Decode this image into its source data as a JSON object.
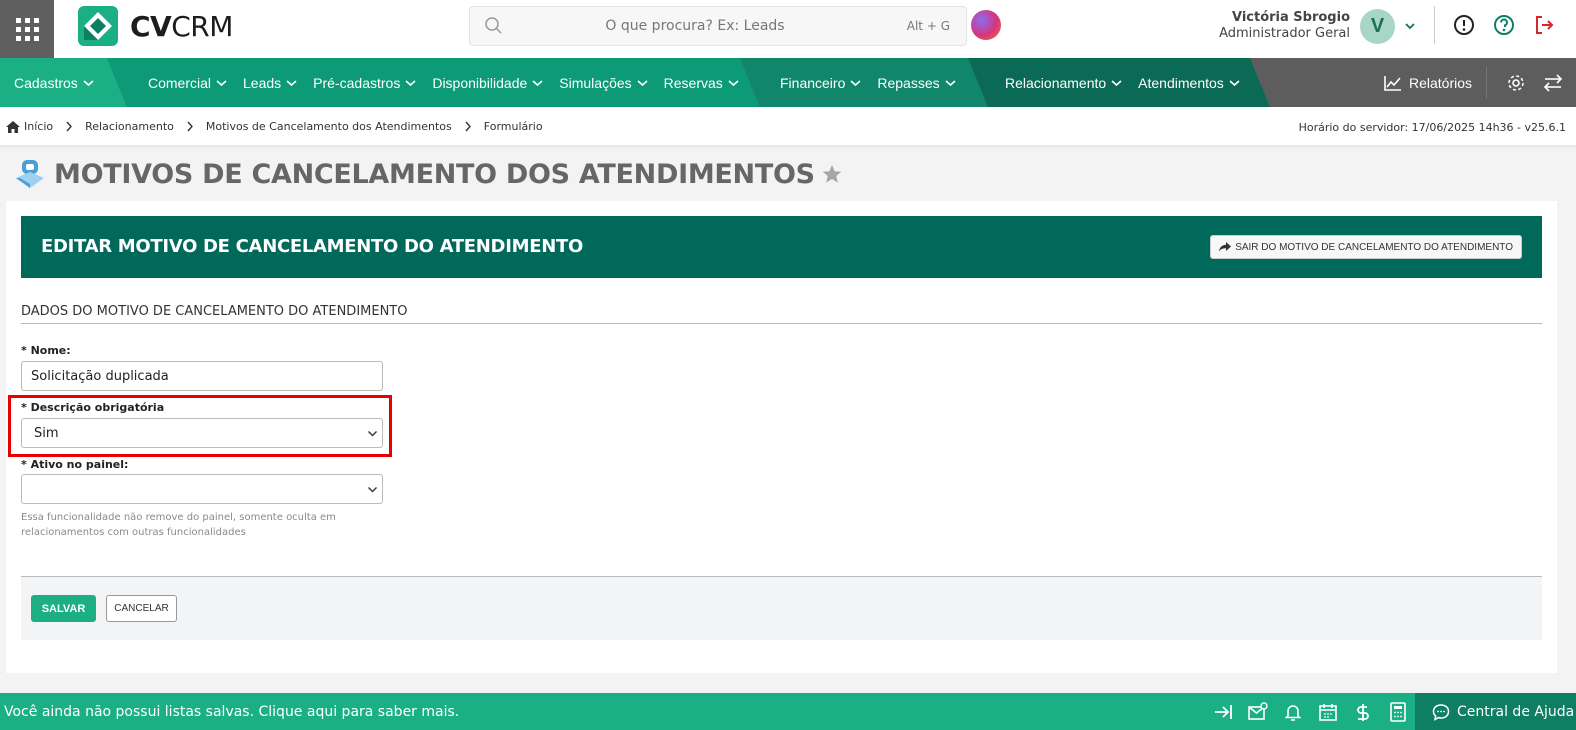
{
  "app": {
    "logo_text_bold": "CV",
    "logo_text_rest": "CRM"
  },
  "search": {
    "placeholder": "O que procura? Ex: Leads",
    "shortcut": "Alt + G"
  },
  "user": {
    "name": "Victória Sbrogio",
    "role": "Administrador Geral",
    "initial": "V"
  },
  "nav": {
    "group1": [
      {
        "label": "Cadastros"
      }
    ],
    "group2": [
      {
        "label": "Comercial"
      },
      {
        "label": "Leads"
      },
      {
        "label": "Pré-cadastros"
      },
      {
        "label": "Disponibilidade"
      },
      {
        "label": "Simulações"
      },
      {
        "label": "Reservas"
      }
    ],
    "group3": [
      {
        "label": "Financeiro"
      },
      {
        "label": "Repasses"
      }
    ],
    "group4": [
      {
        "label": "Relacionamento"
      },
      {
        "label": "Atendimentos"
      }
    ],
    "reports": "Relatórios"
  },
  "breadcrumb": {
    "home": "Início",
    "items": [
      "Relacionamento",
      "Motivos de Cancelamento dos Atendimentos",
      "Formulário"
    ]
  },
  "server_time": "Horário do servidor: 17/06/2025 14h36 - v25.6.1",
  "page": {
    "title": "MOTIVOS DE CANCELAMENTO DOS ATENDIMENTOS"
  },
  "card": {
    "title": "EDITAR MOTIVO DE CANCELAMENTO DO ATENDIMENTO",
    "exit_label": "SAIR DO MOTIVO DE CANCELAMENTO DO ATENDIMENTO",
    "section_title": "DADOS DO MOTIVO DE CANCELAMENTO DO ATENDIMENTO"
  },
  "form": {
    "nome": {
      "label": "* Nome:",
      "value": "Solicitação duplicada"
    },
    "descricao": {
      "label": "* Descrição obrigatória",
      "value": "Sim"
    },
    "ativo": {
      "label": "* Ativo no painel:",
      "value": ""
    },
    "help": "Essa funcionalidade não remove do painel, somente oculta em relacionamentos com outras funcionalidades"
  },
  "buttons": {
    "save": "SALVAR",
    "cancel": "CANCELAR"
  },
  "bottombar": {
    "message": "Você ainda não possui listas salvas. Clique aqui para saber mais.",
    "help_center": "Central de Ajuda"
  },
  "colors": {
    "brand_green": "#1aaf85",
    "header_dark_green": "#00695a",
    "nav_gray": "#5d5d5d",
    "highlight_red": "#e80000"
  }
}
